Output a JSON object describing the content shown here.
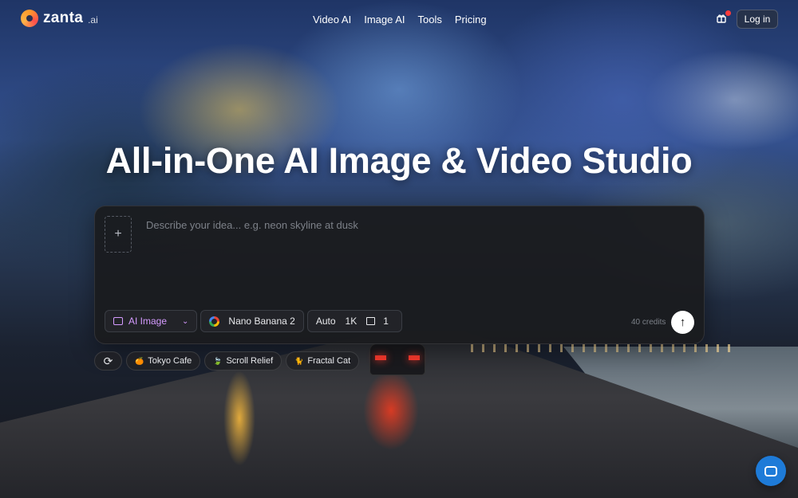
{
  "brand": {
    "name": "zanta",
    "suffix": ".ai"
  },
  "nav": [
    "Video AI",
    "Image AI",
    "Tools",
    "Pricing"
  ],
  "header": {
    "login_label": "Log in",
    "gift_icon": "gift-icon",
    "notification_color": "#ff3b3b"
  },
  "hero": {
    "title": "All-in-One AI Image & Video Studio"
  },
  "composer": {
    "add_symbol": "+",
    "placeholder": "Describe your idea... e.g. neon skyline at dusk",
    "mode": "AI Image",
    "model": "Nano Banana 2",
    "aspect": "Auto",
    "resolution": "1K",
    "count": "1",
    "credits": "40 credits",
    "submit_symbol": "↑"
  },
  "suggestions": {
    "refresh_symbol": "⟳",
    "items": [
      {
        "label": "Tokyo Cafe",
        "icon": "🍊"
      },
      {
        "label": "Scroll Relief",
        "icon": "🍃"
      },
      {
        "label": "Fractal Cat",
        "icon": "🐈"
      }
    ]
  },
  "colors": {
    "accent_purple": "#d59bff",
    "chat_blue": "#1e7bd8"
  }
}
